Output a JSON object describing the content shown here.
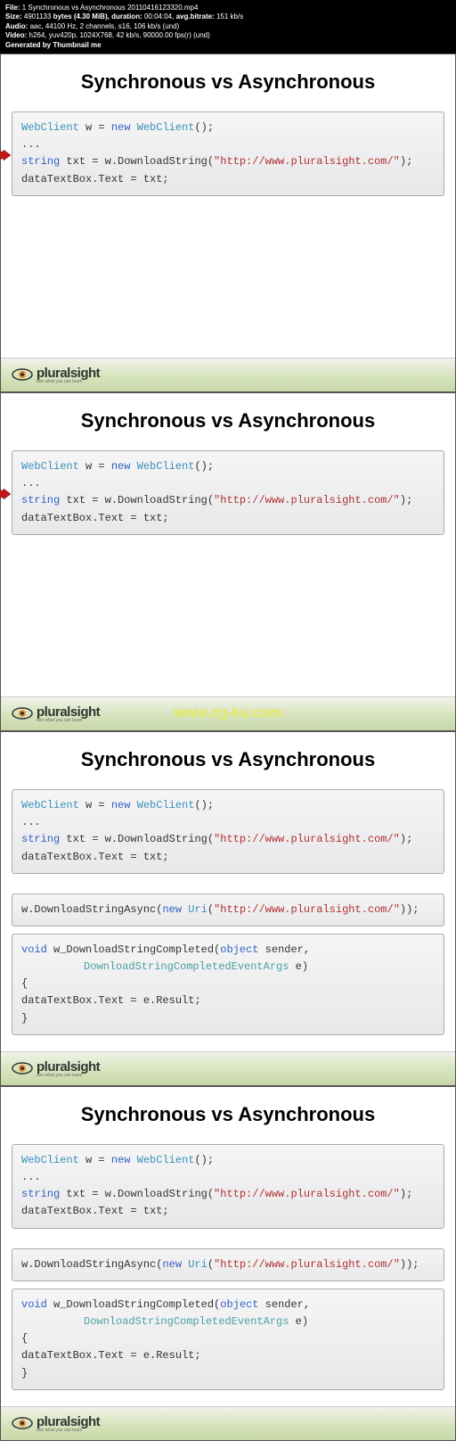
{
  "header": {
    "file_label": "File:",
    "file_value": "1 Synchronous vs Asynchronous 20110416123320.mp4",
    "size_label": "Size:",
    "size_bytes": "4901133",
    "size_unit": "bytes (4.30 MiB),",
    "duration_label": "duration:",
    "duration_value": "00:04:04,",
    "avgbitrate_label": "avg.bitrate:",
    "avgbitrate_value": "151 kb/s",
    "audio_label": "Audio:",
    "audio_value": "aac, 44100 Hz, 2 channels, s16, 106 kb/s (und)",
    "video_label": "Video:",
    "video_value": "h264, yuv420p, 1024X768, 42 kb/s, 90000.00 fps(r) (und)",
    "generated": "Generated by Thumbnail me"
  },
  "title": "Synchronous vs Asynchronous",
  "code1": {
    "l1a": "WebClient",
    "l1b": " w = ",
    "l1c": "new",
    "l1d": " WebClient",
    "l1e": "();",
    "l2": "...",
    "l3a": "string",
    "l3b": " txt = w.DownloadString(",
    "l3c": "\"http://www.pluralsight.com/\"",
    "l3d": ");",
    "l4": "dataTextBox.Text = txt;"
  },
  "code2": {
    "l1a": "w.DownloadStringAsync(",
    "l1b": "new",
    "l1c": " Uri",
    "l1d": "(",
    "l1e": "\"http://www.pluralsight.com/\"",
    "l1f": "));"
  },
  "code3": {
    "l1a": "void",
    "l1b": " w_DownloadStringCompleted(",
    "l1c": "object",
    "l1d": " sender,",
    "l2a": "DownloadStringCompletedEventArgs",
    "l2b": " e)",
    "l3": "{",
    "l4": "   dataTextBox.Text = e.Result;",
    "l5": "}"
  },
  "brand": "pluralsight",
  "tagline": "see what you can learn",
  "watermark": "www.cg-ku.com"
}
